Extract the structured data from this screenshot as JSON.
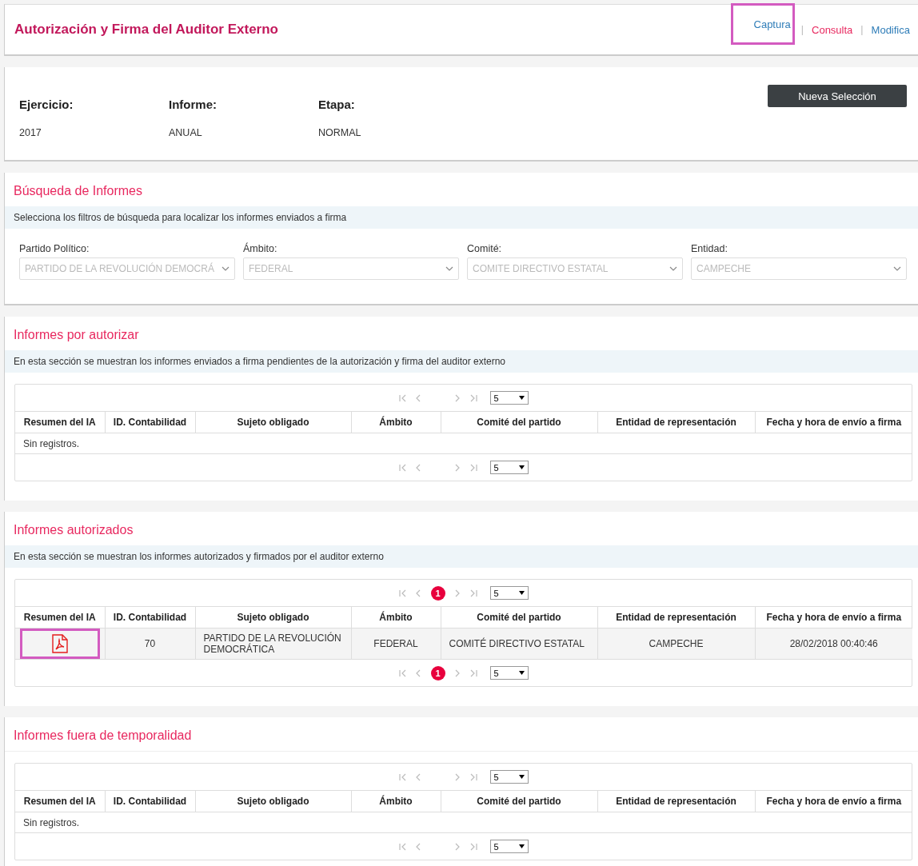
{
  "header": {
    "title": "Autorización y Firma del Auditor Externo",
    "nav": [
      {
        "label": "Captura",
        "selected": false,
        "highlighted": true
      },
      {
        "separator": "|",
        "label": "Consulta",
        "selected": true,
        "highlighted": false
      },
      {
        "separator": "|",
        "label": "Modifica",
        "selected": false,
        "highlighted": false
      }
    ]
  },
  "selection": {
    "fields": [
      {
        "label": "Ejercicio:",
        "value": "2017"
      },
      {
        "label": "Informe:",
        "value": "ANUAL"
      },
      {
        "label": "Etapa:",
        "value": "NORMAL"
      }
    ],
    "button": "Nueva Selección"
  },
  "search": {
    "title": "Búsqueda de Informes",
    "description": "Selecciona los filtros de búsqueda para localizar los informes enviados a firma",
    "filters": [
      {
        "label": "Partido Político:",
        "value": "PARTIDO DE LA REVOLUCIÓN DEMOCRÁ",
        "disabled": true
      },
      {
        "label": "Ámbito:",
        "value": "FEDERAL",
        "disabled": true
      },
      {
        "label": "Comité:",
        "value": "COMITE DIRECTIVO ESTATAL",
        "disabled": true
      },
      {
        "label": "Entidad:",
        "value": "CAMPECHE",
        "disabled": true
      }
    ]
  },
  "sections": [
    {
      "title": "Informes por autorizar",
      "description": "En esta sección se muestran los informes enviados a firma pendientes de la autorización y firma del auditor externo",
      "table": {
        "pager_top": {
          "page_size": "5"
        },
        "pager_bottom": {
          "page_size": "5"
        },
        "columns": [
          "Resumen del IA",
          "ID. Contabilidad",
          "Sujeto obligado",
          "Ámbito",
          "Comité del partido",
          "Entidad de representación",
          "Fecha y hora de envío a firma"
        ],
        "empty_text": "Sin registros."
      }
    },
    {
      "title": "Informes autorizados",
      "description": "En esta sección se muestran los informes autorizados y firmados por el auditor externo",
      "table": {
        "pager_top": {
          "page": "1",
          "page_size": "5"
        },
        "pager_bottom": {
          "page": "1",
          "page_size": "5"
        },
        "columns": [
          "Resumen del IA",
          "ID. Contabilidad",
          "Sujeto obligado",
          "Ámbito",
          "Comité del partido",
          "Entidad de representación",
          "Fecha y hora de envío a firma"
        ],
        "rows": [
          {
            "highlighted": true,
            "cells": [
              "",
              "70",
              "PARTIDO DE LA REVOLUCIÓN DEMOCRÁTICA",
              "FEDERAL",
              "COMITÉ DIRECTIVO ESTATAL",
              "CAMPECHE",
              "28/02/2018 00:40:46"
            ]
          }
        ]
      }
    },
    {
      "title": "Informes fuera de temporalidad",
      "table": {
        "pager_top": {
          "page_size": "5"
        },
        "pager_bottom": {
          "page_size": "5"
        },
        "columns": [
          "Resumen del IA",
          "ID. Contabilidad",
          "Sujeto obligado",
          "Ámbito",
          "Comité del partido",
          "Entidad de representación",
          "Fecha y hora de envío a firma"
        ],
        "empty_text": "Sin registros."
      }
    }
  ]
}
